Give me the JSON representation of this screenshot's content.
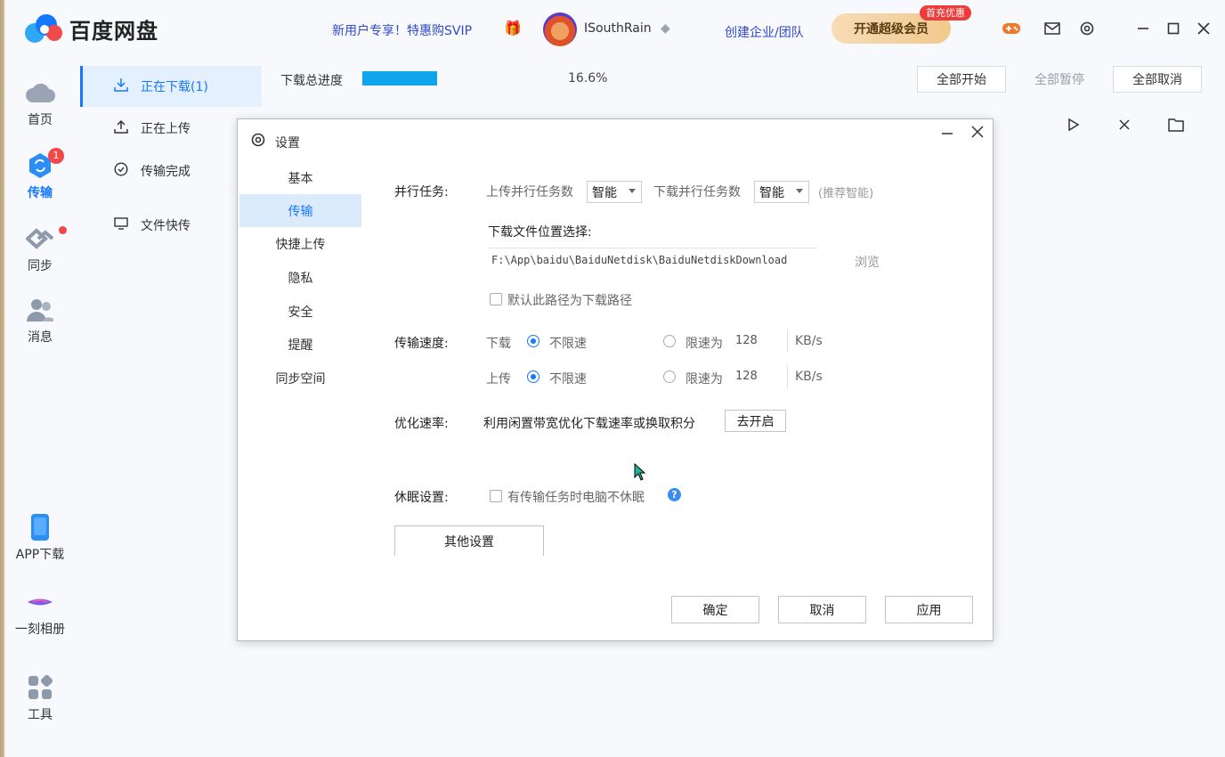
{
  "app": {
    "name": "百度网盘"
  },
  "header": {
    "promo": "新用户专享！特惠购SVIP",
    "username": "ISouthRain",
    "enterprise": "创建企业/团队",
    "svip_button": "开通超级会员",
    "svip_tag": "首充优惠",
    "icons": [
      "gift-icon",
      "game-icon",
      "mail-icon",
      "settings-icon",
      "minimize-icon",
      "maximize-icon",
      "close-icon"
    ]
  },
  "rail": {
    "home": "首页",
    "transfer": "传输",
    "transfer_badge": "1",
    "sync": "同步",
    "messages": "消息",
    "app_download": "APP下载",
    "album": "一刻相册",
    "tools": "工具"
  },
  "sidebar": {
    "items": [
      {
        "label": "正在下载(1)",
        "icon": "download-icon"
      },
      {
        "label": "正在上传",
        "icon": "upload-icon"
      },
      {
        "label": "传输完成",
        "icon": "check-circle-icon"
      },
      {
        "label": "文件快传",
        "icon": "monitor-icon"
      }
    ]
  },
  "downloads": {
    "total_label": "下载总进度",
    "progress_pct": 16.6,
    "progress_text": "16.6%",
    "start_all": "全部开始",
    "pause_all": "全部暂停",
    "cancel_all": "全部取消"
  },
  "dialog": {
    "title": "设置",
    "nav": [
      "基本",
      "传输",
      "快捷上传",
      "隐私",
      "安全",
      "提醒",
      "同步空间"
    ],
    "active_nav": "传输",
    "parallel": {
      "label": "并行任务:",
      "upload_label": "上传并行任务数",
      "upload_value": "智能",
      "download_label": "下载并行任务数",
      "download_value": "智能",
      "hint": "(推荐智能)"
    },
    "location": {
      "label": "下载文件位置选择:",
      "path": "F:\\App\\baidu\\BaiduNetdisk\\BaiduNetdiskDownload",
      "browse": "浏览",
      "default_checkbox": "默认此路径为下载路径"
    },
    "speed": {
      "label": "传输速度:",
      "download_label": "下载",
      "upload_label": "上传",
      "unlimited": "不限速",
      "limit_to": "限速为",
      "download_limit": "128",
      "upload_limit": "128",
      "unit": "KB/s"
    },
    "optimize": {
      "label": "优化速率:",
      "text": "利用闲置带宽优化下载速率或换取积分",
      "button": "去开启"
    },
    "sleep": {
      "label": "休眠设置:",
      "checkbox": "有传输任务时电脑不休眠"
    },
    "other_settings": "其他设置",
    "ok": "确定",
    "cancel": "取消",
    "apply": "应用"
  }
}
